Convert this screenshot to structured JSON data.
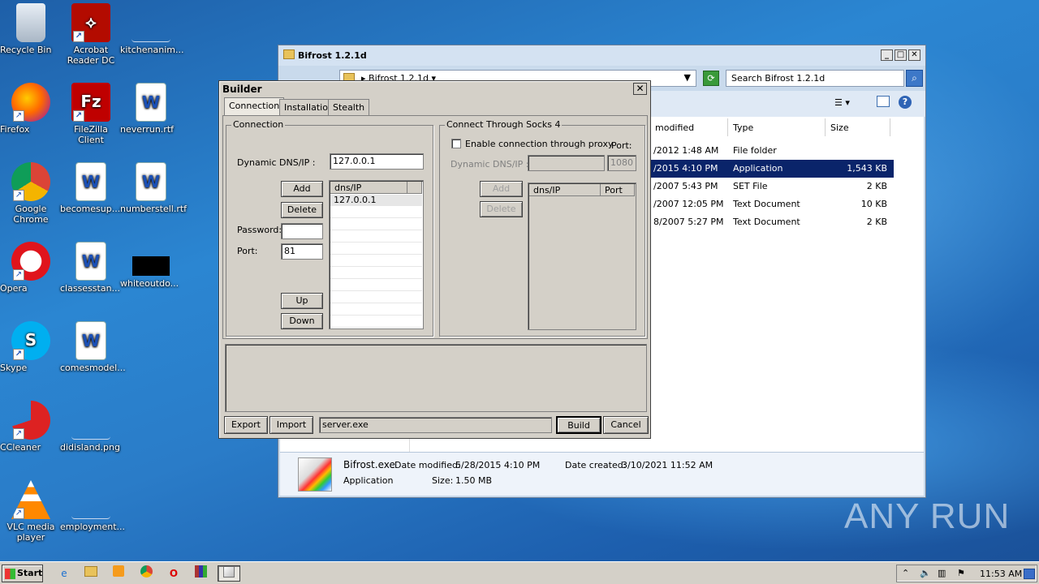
{
  "desktop": {
    "icons": [
      {
        "label": "Recycle Bin",
        "icon": "recycle-bin-icon"
      },
      {
        "label": "Acrobat Reader DC",
        "icon": "acrobat-icon"
      },
      {
        "label": "kitchenanim...",
        "icon": "file-icon"
      },
      {
        "label": "Firefox",
        "icon": "firefox-icon"
      },
      {
        "label": "FileZilla Client",
        "icon": "filezilla-icon"
      },
      {
        "label": "neverrun.rtf",
        "icon": "word-doc-icon"
      },
      {
        "label": "Google Chrome",
        "icon": "chrome-icon"
      },
      {
        "label": "becomesup...",
        "icon": "word-doc-icon"
      },
      {
        "label": "numberstell.rtf",
        "icon": "word-doc-icon"
      },
      {
        "label": "Opera",
        "icon": "opera-icon"
      },
      {
        "label": "classesstan...",
        "icon": "word-doc-icon"
      },
      {
        "label": "whiteoutdo...",
        "icon": "black-file-icon"
      },
      {
        "label": "Skype",
        "icon": "skype-icon"
      },
      {
        "label": "comesmodel...",
        "icon": "word-doc-icon"
      },
      {
        "label": "CCleaner",
        "icon": "ccleaner-icon"
      },
      {
        "label": "didisland.png",
        "icon": "image-file-icon"
      },
      {
        "label": "VLC media player",
        "icon": "vlc-icon"
      },
      {
        "label": "employment...",
        "icon": "file-icon"
      }
    ]
  },
  "explorer": {
    "title": "Bifrost 1.2.1d",
    "address": "Bifrost 1.2.1d",
    "search_placeholder": "Search Bifrost 1.2.1d",
    "columns": [
      "modified",
      "Type",
      "Size"
    ],
    "rows": [
      {
        "date": "/2012 1:48 AM",
        "type": "File folder",
        "size": ""
      },
      {
        "date": "/2015 4:10 PM",
        "type": "Application",
        "size": "1,543 KB"
      },
      {
        "date": "/2007 5:43 PM",
        "type": "SET File",
        "size": "2 KB"
      },
      {
        "date": "/2007 12:05 PM",
        "type": "Text Document",
        "size": "10 KB"
      },
      {
        "date": "8/2007 5:27 PM",
        "type": "Text Document",
        "size": "2 KB"
      }
    ],
    "details": {
      "name": "Bifrost.exe",
      "modified_label": "Date modified:",
      "modified": "5/28/2015 4:10 PM",
      "created_label": "Date created:",
      "created": "3/10/2021 11:52 AM",
      "type": "Application",
      "size_label": "Size:",
      "size": "1.50 MB"
    }
  },
  "builder": {
    "title": "Builder",
    "tabs": [
      "Connection",
      "Installation",
      "Stealth"
    ],
    "connection": {
      "group": "Connection",
      "dns_label": "Dynamic DNS/IP :",
      "dns_value": "127.0.0.1",
      "add": "Add",
      "delete": "Delete",
      "password_label": "Password:",
      "password_value": "",
      "port_label": "Port:",
      "port_value": "81",
      "up": "Up",
      "down": "Down",
      "list_header": "dns/IP",
      "list_items": [
        "127.0.0.1"
      ]
    },
    "socks": {
      "group": "Connect Through Socks 4",
      "enable_label": "Enable connection through proxy",
      "port_label": "Port:",
      "dns_label": "Dynamic DNS/IP :",
      "port_value": "1080",
      "add": "Add",
      "delete": "Delete",
      "col1": "dns/IP",
      "col2": "Port"
    },
    "footer": {
      "export": "Export",
      "import": "Import",
      "filename": "server.exe",
      "build": "Build",
      "cancel": "Cancel"
    }
  },
  "taskbar": {
    "start": "Start",
    "clock": "11:53 AM"
  },
  "watermark": "ANY RUN"
}
